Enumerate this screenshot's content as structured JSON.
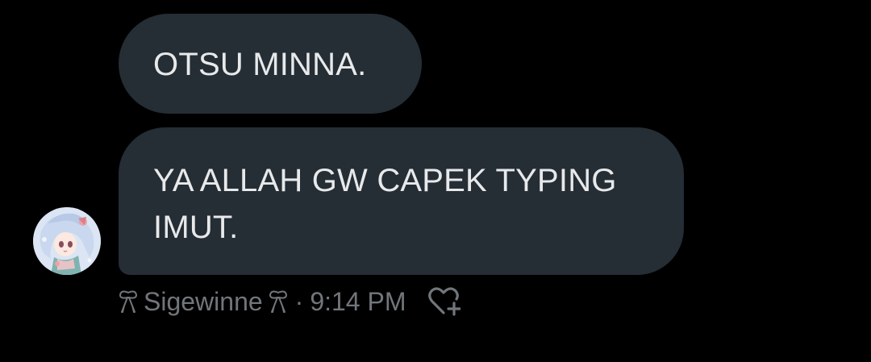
{
  "messages": [
    {
      "text": "OTSU MINNA."
    },
    {
      "text": "YA ALLAH GW CAPEK TYPING\nIMUT."
    }
  ],
  "sender": {
    "name": "Sigewinne",
    "separator": "·",
    "time": "9:14 PM"
  },
  "icons": {
    "name_decor": "ribbon-bow-icon",
    "reaction": "heart-plus-icon"
  },
  "colors": {
    "background": "#000000",
    "bubble": "#252d35",
    "bubble_text": "#e7e9ea",
    "meta_text": "#71767b"
  }
}
